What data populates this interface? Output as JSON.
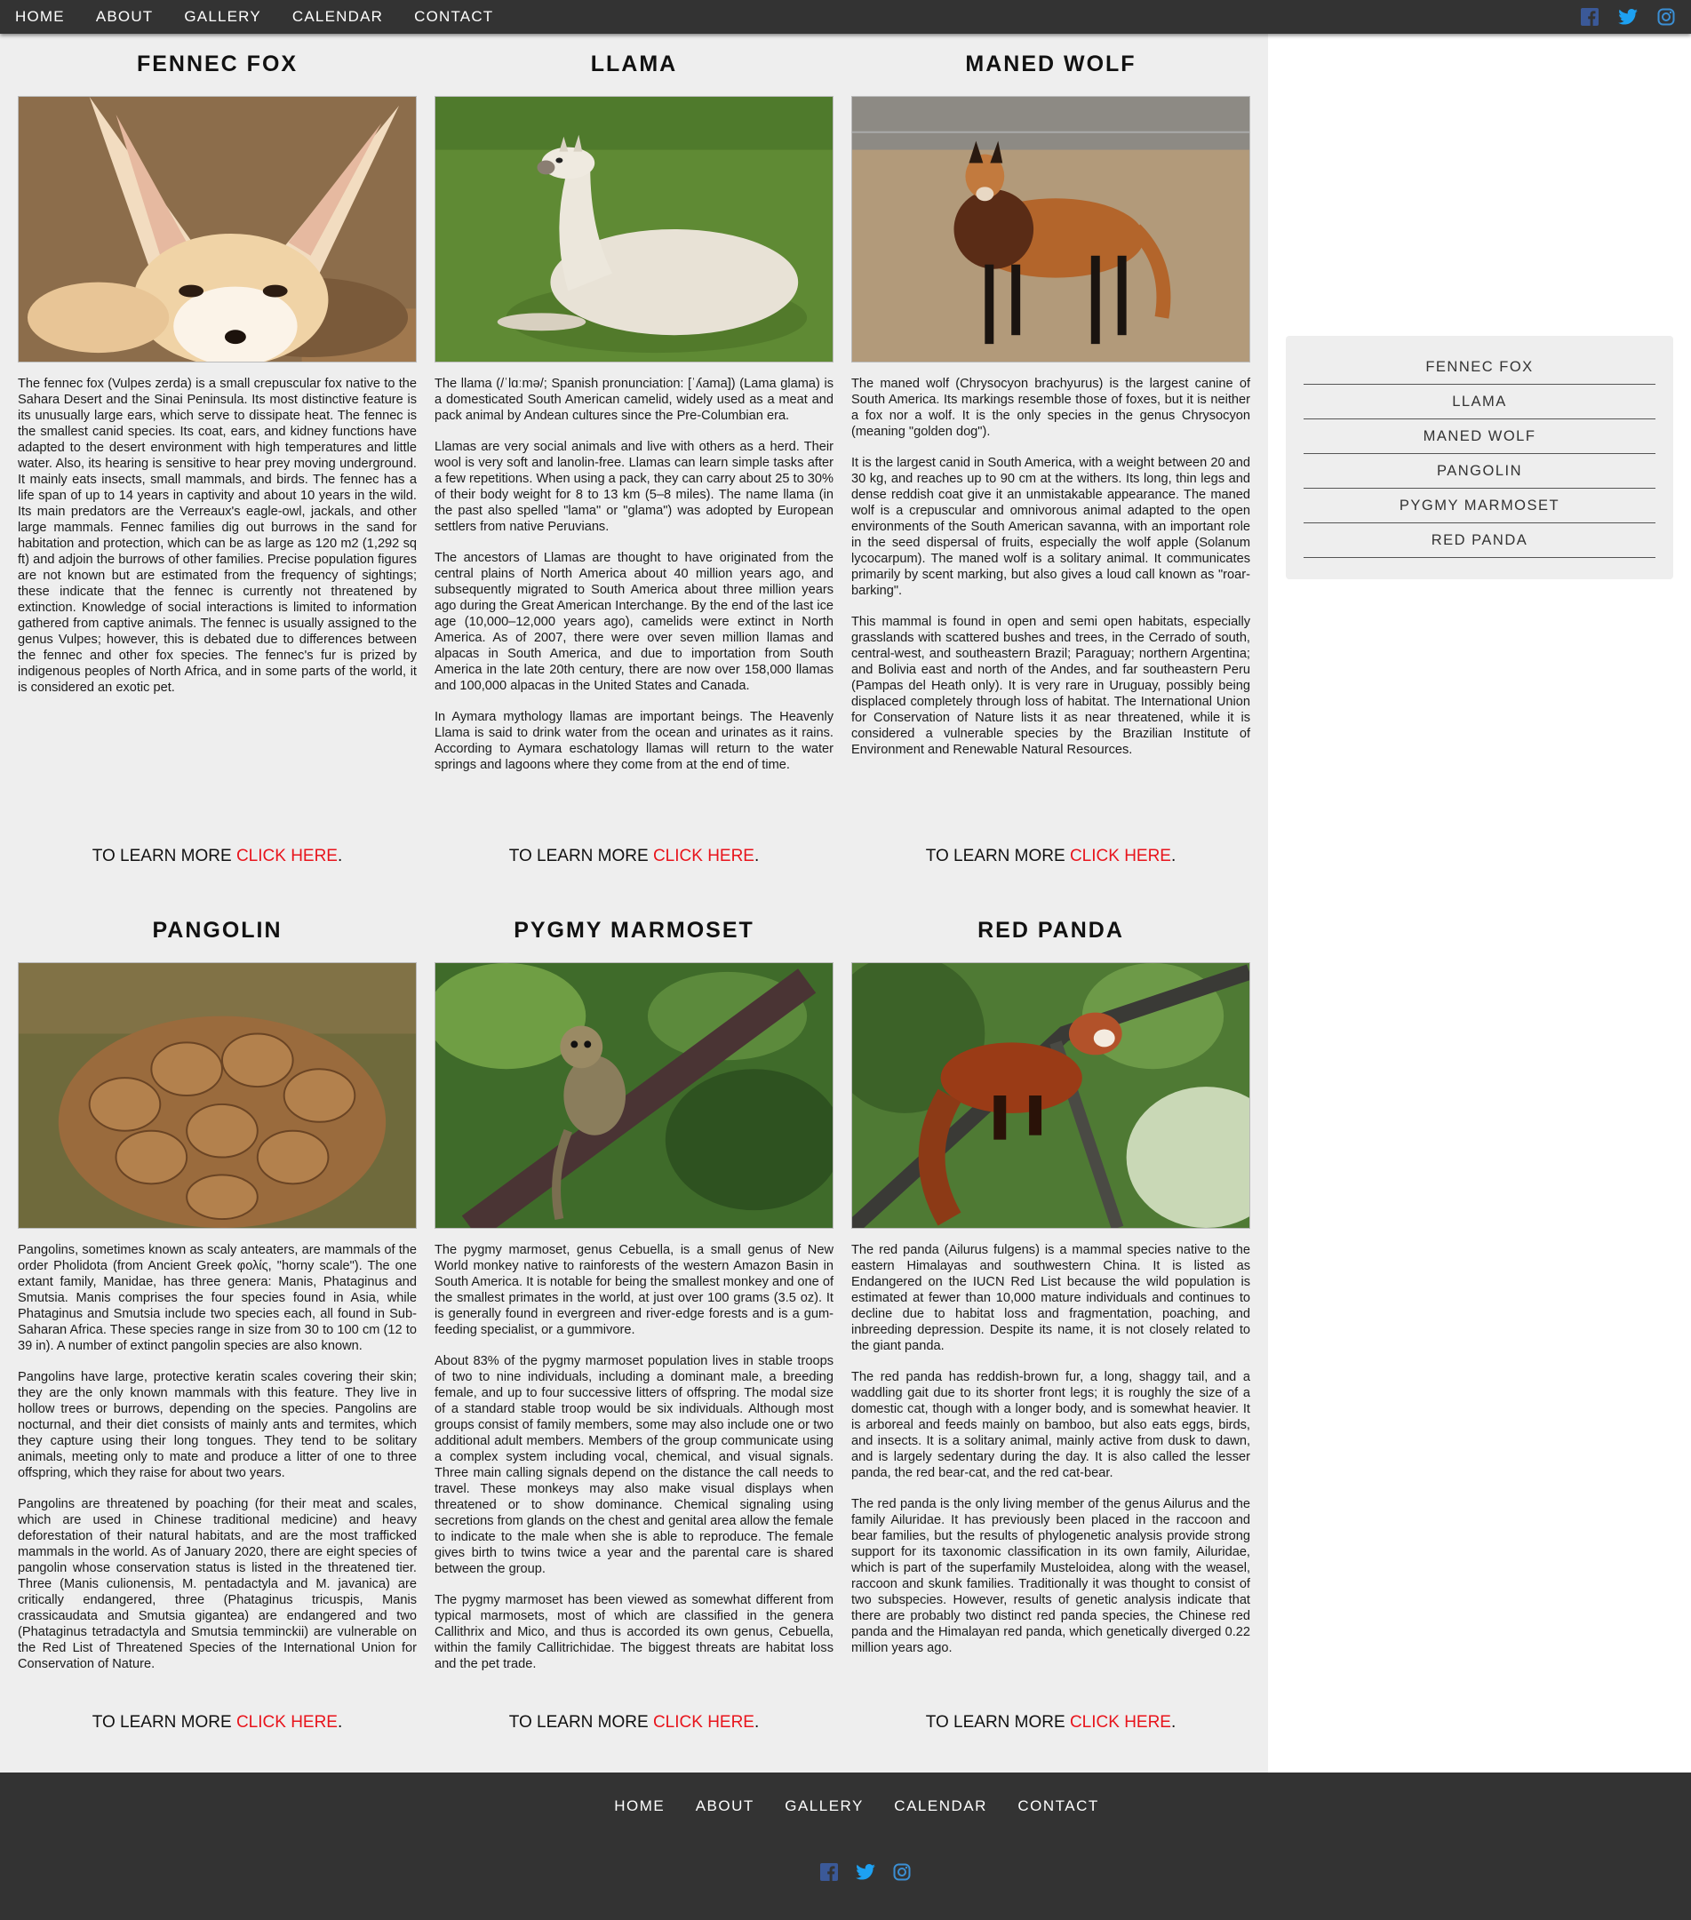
{
  "nav": {
    "items": [
      "HOME",
      "ABOUT",
      "GALLERY",
      "CALENDAR",
      "CONTACT"
    ],
    "social": [
      "facebook-icon",
      "twitter-icon",
      "instagram-icon"
    ]
  },
  "colors": {
    "nav_bg": "#333333",
    "main_bg": "#eeeeee",
    "link_red": "#e8141c",
    "social_blue": "#3b5998"
  },
  "learn_more": {
    "prefix": "TO LEARN MORE ",
    "link": "CLICK HERE",
    "suffix": "."
  },
  "animals": [
    {
      "title": "FENNEC FOX",
      "paragraphs": [
        "The fennec fox (Vulpes zerda) is a small crepuscular fox native to the Sahara Desert and the Sinai Peninsula. Its most distinctive feature is its unusually large ears, which serve to dissipate heat. The fennec is the smallest canid species. Its coat, ears, and kidney functions have adapted to the desert environment with high temperatures and little water. Also, its hearing is sensitive to hear prey moving underground. It mainly eats insects, small mammals, and birds. The fennec has a life span of up to 14 years in captivity and about 10 years in the wild. Its main predators are the Verreaux's eagle-owl, jackals, and other large mammals. Fennec families dig out burrows in the sand for habitation and protection, which can be as large as 120 m2 (1,292 sq ft) and adjoin the burrows of other families. Precise population figures are not known but are estimated from the frequency of sightings; these indicate that the fennec is currently not threatened by extinction. Knowledge of social interactions is limited to information gathered from captive animals. The fennec is usually assigned to the genus Vulpes; however, this is debated due to differences between the fennec and other fox species. The fennec's fur is prized by indigenous peoples of North Africa, and in some parts of the world, it is considered an exotic pet."
      ]
    },
    {
      "title": "LLAMA",
      "paragraphs": [
        "The llama (/ˈlɑːmə/; Spanish pronunciation: [ˈʎama]) (Lama glama) is a domesticated South American camelid, widely used as a meat and pack animal by Andean cultures since the Pre-Columbian era.",
        "Llamas are very social animals and live with others as a herd. Their wool is very soft and lanolin-free. Llamas can learn simple tasks after a few repetitions. When using a pack, they can carry about 25 to 30% of their body weight for 8 to 13 km (5–8 miles). The name llama (in the past also spelled \"lama\" or \"glama\") was adopted by European settlers from native Peruvians.",
        "The ancestors of Llamas are thought to have originated from the central plains of North America about 40 million years ago, and subsequently migrated to South America about three million years ago during the Great American Interchange. By the end of the last ice age (10,000–12,000 years ago), camelids were extinct in North America. As of 2007, there were over seven million llamas and alpacas in South America, and due to importation from South America in the late 20th century, there are now over 158,000 llamas and 100,000 alpacas in the United States and Canada.",
        "In Aymara mythology llamas are important beings. The Heavenly Llama is said to drink water from the ocean and urinates as it rains. According to Aymara eschatology llamas will return to the water springs and lagoons where they come from at the end of time."
      ]
    },
    {
      "title": "MANED WOLF",
      "paragraphs": [
        "The maned wolf (Chrysocyon brachyurus) is the largest canine of South America. Its markings resemble those of foxes, but it is neither a fox nor a wolf. It is the only species in the genus Chrysocyon (meaning \"golden dog\").",
        "It is the largest canid in South America, with a weight between 20 and 30 kg, and reaches up to 90 cm at the withers. Its long, thin legs and dense reddish coat give it an unmistakable appearance. The maned wolf is a crepuscular and omnivorous animal adapted to the open environments of the South American savanna, with an important role in the seed dispersal of fruits, especially the wolf apple (Solanum lycocarpum). The maned wolf is a solitary animal. It communicates primarily by scent marking, but also gives a loud call known as \"roar-barking\".",
        "This mammal is found in open and semi open habitats, especially grasslands with scattered bushes and trees, in the Cerrado of south, central-west, and southeastern Brazil; Paraguay; northern Argentina; and Bolivia east and north of the Andes, and far southeastern Peru (Pampas del Heath only). It is very rare in Uruguay, possibly being displaced completely through loss of habitat. The International Union for Conservation of Nature lists it as near threatened, while it is considered a vulnerable species by the Brazilian Institute of Environment and Renewable Natural Resources."
      ]
    },
    {
      "title": "PANGOLIN",
      "paragraphs": [
        "Pangolins, sometimes known as scaly anteaters, are mammals of the order Pholidota (from Ancient Greek φολίς, \"horny scale\"). The one extant family, Manidae, has three genera: Manis, Phataginus and Smutsia. Manis comprises the four species found in Asia, while Phataginus and Smutsia include two species each, all found in Sub-Saharan Africa. These species range in size from 30 to 100 cm (12 to 39 in). A number of extinct pangolin species are also known.",
        "Pangolins have large, protective keratin scales covering their skin; they are the only known mammals with this feature. They live in hollow trees or burrows, depending on the species. Pangolins are nocturnal, and their diet consists of mainly ants and termites, which they capture using their long tongues. They tend to be solitary animals, meeting only to mate and produce a litter of one to three offspring, which they raise for about two years.",
        "Pangolins are threatened by poaching (for their meat and scales, which are used in Chinese traditional medicine) and heavy deforestation of their natural habitats, and are the most trafficked mammals in the world. As of January 2020, there are eight species of pangolin whose conservation status is listed in the threatened tier. Three (Manis culionensis, M. pentadactyla and M. javanica) are critically endangered, three (Phataginus tricuspis, Manis crassicaudata and Smutsia gigantea) are endangered and two (Phataginus tetradactyla and Smutsia temminckii) are vulnerable on the Red List of Threatened Species of the International Union for Conservation of Nature."
      ]
    },
    {
      "title": "PYGMY MARMOSET",
      "paragraphs": [
        "The pygmy marmoset, genus Cebuella, is a small genus of New World monkey native to rainforests of the western Amazon Basin in South America. It is notable for being the smallest monkey and one of the smallest primates in the world, at just over 100 grams (3.5 oz). It is generally found in evergreen and river-edge forests and is a gum-feeding specialist, or a gummivore.",
        "About 83% of the pygmy marmoset population lives in stable troops of two to nine individuals, including a dominant male, a breeding female, and up to four successive litters of offspring. The modal size of a standard stable troop would be six individuals. Although most groups consist of family members, some may also include one or two additional adult members. Members of the group communicate using a complex system including vocal, chemical, and visual signals. Three main calling signals depend on the distance the call needs to travel. These monkeys may also make visual displays when threatened or to show dominance. Chemical signaling using secretions from glands on the chest and genital area allow the female to indicate to the male when she is able to reproduce. The female gives birth to twins twice a year and the parental care is shared between the group.",
        "The pygmy marmoset has been viewed as somewhat different from typical marmosets, most of which are classified in the genera Callithrix and Mico, and thus is accorded its own genus, Cebuella, within the family Callitrichidae. The biggest threats are habitat loss and the pet trade."
      ]
    },
    {
      "title": "RED PANDA",
      "paragraphs": [
        "The red panda (Ailurus fulgens) is a mammal species native to the eastern Himalayas and southwestern China. It is listed as Endangered on the IUCN Red List because the wild population is estimated at fewer than 10,000 mature individuals and continues to decline due to habitat loss and fragmentation, poaching, and inbreeding depression. Despite its name, it is not closely related to the giant panda.",
        "The red panda has reddish-brown fur, a long, shaggy tail, and a waddling gait due to its shorter front legs; it is roughly the size of a domestic cat, though with a longer body, and is somewhat heavier. It is arboreal and feeds mainly on bamboo, but also eats eggs, birds, and insects. It is a solitary animal, mainly active from dusk to dawn, and is largely sedentary during the day. It is also called the lesser panda, the red bear-cat, and the red cat-bear.",
        "The red panda is the only living member of the genus Ailurus and the family Ailuridae. It has previously been placed in the raccoon and bear families, but the results of phylogenetic analysis provide strong support for its taxonomic classification in its own family, Ailuridae, which is part of the superfamily Musteloidea, along with the weasel, raccoon and skunk families. Traditionally it was thought to consist of two subspecies. However, results of genetic analysis indicate that there are probably two distinct red panda species, the Chinese red panda and the Himalayan red panda, which genetically diverged 0.22 million years ago."
      ]
    }
  ],
  "sidebar": {
    "items": [
      "FENNEC FOX",
      "LLAMA",
      "MANED WOLF",
      "PANGOLIN",
      "PYGMY MARMOSET",
      "RED PANDA"
    ]
  },
  "footer": {
    "items": [
      "HOME",
      "ABOUT",
      "GALLERY",
      "CALENDAR",
      "CONTACT"
    ],
    "social": [
      "facebook-icon",
      "twitter-icon",
      "instagram-icon"
    ]
  }
}
